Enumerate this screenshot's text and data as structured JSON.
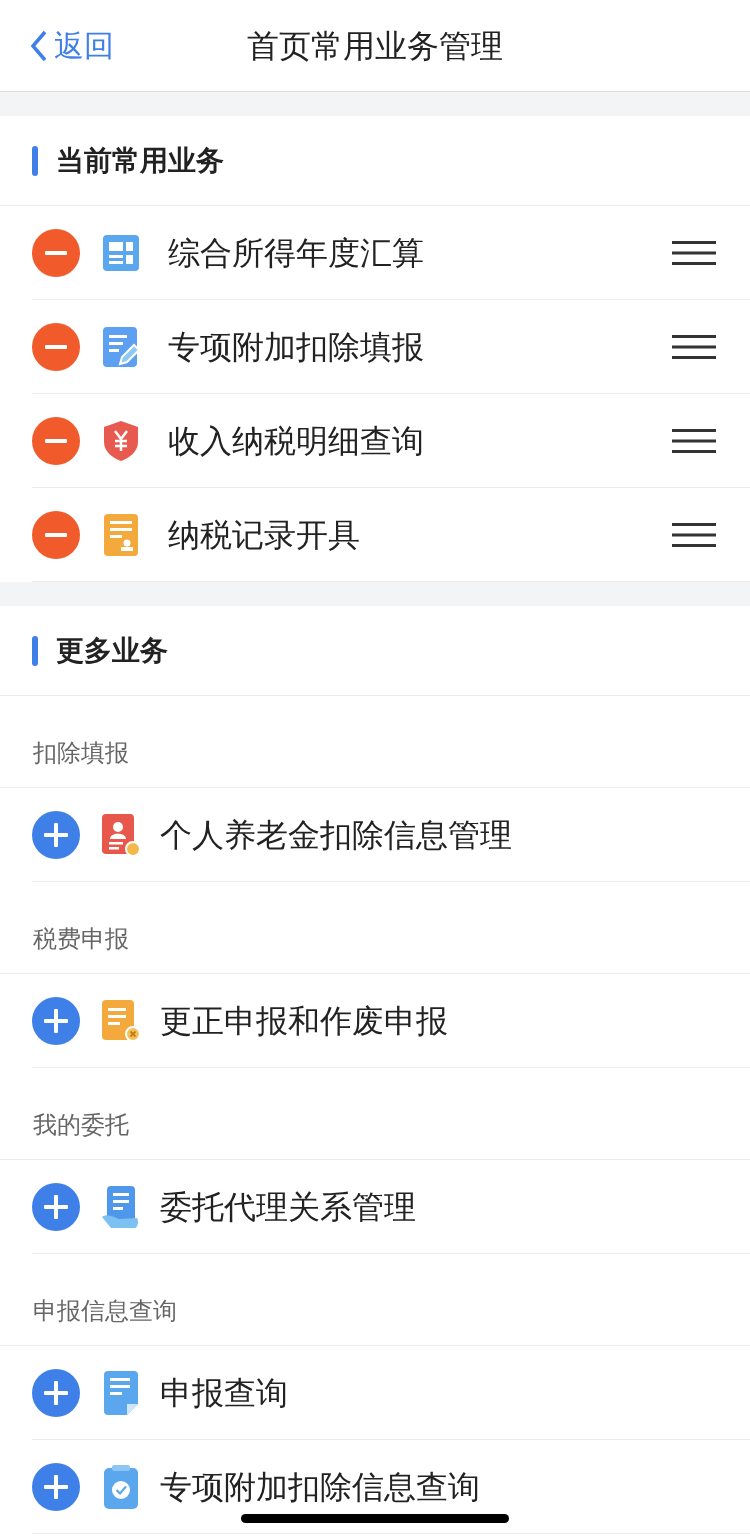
{
  "nav": {
    "back": "返回",
    "title": "首页常用业务管理"
  },
  "current": {
    "title": "当前常用业务",
    "items": [
      "综合所得年度汇算",
      "专项附加扣除填报",
      "收入纳税明细查询",
      "纳税记录开具"
    ]
  },
  "more": {
    "title": "更多业务",
    "groups": [
      {
        "label": "扣除填报",
        "items": [
          "个人养老金扣除信息管理"
        ]
      },
      {
        "label": "税费申报",
        "items": [
          "更正申报和作废申报"
        ]
      },
      {
        "label": "我的委托",
        "items": [
          "委托代理关系管理"
        ]
      },
      {
        "label": "申报信息查询",
        "items": [
          "申报查询",
          "专项附加扣除信息查询"
        ]
      }
    ]
  }
}
